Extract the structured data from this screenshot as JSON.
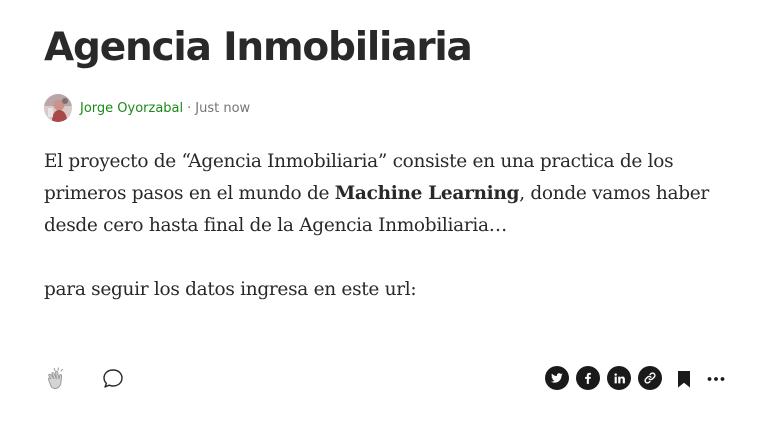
{
  "article": {
    "title": "Agencia Inmobiliaria",
    "author": "Jorge Oyorzabal",
    "separator": "·",
    "timestamp": "Just now",
    "paragraph1": {
      "before": "El proyecto de “Agencia Inmobiliaria” consiste en una practica de los primeros pasos en el mundo de ",
      "bold": "Machine Learning",
      "after": ", donde vamos haber desde cero hasta final de la Agencia Inmobiliaria…"
    },
    "paragraph2": "para seguir los datos ingresa en este url:"
  },
  "actions": {
    "left": [
      "clap-icon",
      "comment-icon"
    ],
    "right": [
      "twitter-icon",
      "facebook-icon",
      "linkedin-icon",
      "link-icon",
      "bookmark-icon",
      "more-icon"
    ]
  },
  "colors": {
    "author": "#1a8917",
    "meta": "#757575",
    "text": "#292929",
    "icon": "#1a1a1a"
  }
}
